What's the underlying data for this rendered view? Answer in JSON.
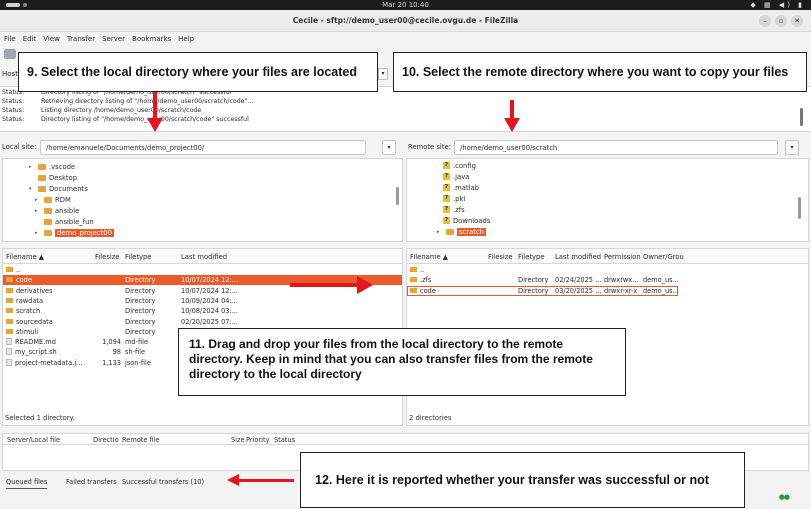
{
  "topbar": {
    "clock": "Mar 20  10:40",
    "tray": "◆ ▦ ◀) ▮"
  },
  "window": {
    "title": "Cecile - sftp://demo_user00@cecile.ovgu.de - FileZilla",
    "minimize": "–",
    "maximize": "▫",
    "close": "✕"
  },
  "menu": [
    "File",
    "Edit",
    "View",
    "Transfer",
    "Server",
    "Bookmarks",
    "Help"
  ],
  "quickconnect": {
    "host_label": "Host:",
    "dropdown": "▾"
  },
  "log": [
    {
      "k": "Status:",
      "v": "Directory listing of \"/home/demo_user00/scratch\" successful"
    },
    {
      "k": "Status:",
      "v": "Retrieving directory listing of \"/home/demo_user00/scratch/code\"..."
    },
    {
      "k": "Status:",
      "v": "Listing directory /home/demo_user00/scratch/code"
    },
    {
      "k": "Status:",
      "v": "Directory listing of \"/home/demo_user00/scratch/code\" successful"
    }
  ],
  "local": {
    "site_label": "Local site:",
    "path": "/home/emanuele/Documents/demo_project00/",
    "tree": [
      {
        "label": ".vscode",
        "indent": 1,
        "exp": "▸"
      },
      {
        "label": "Desktop",
        "indent": 1,
        "exp": ""
      },
      {
        "label": "Documents",
        "indent": 1,
        "exp": "▾"
      },
      {
        "label": "RDM",
        "indent": 2,
        "exp": "▸"
      },
      {
        "label": "ansible",
        "indent": 2,
        "exp": "▸"
      },
      {
        "label": "ansible_fun",
        "indent": 2,
        "exp": ""
      },
      {
        "label": "demo_project00",
        "indent": 2,
        "exp": "▸",
        "selected": true
      }
    ],
    "headers": {
      "name": "Filename ▲",
      "size": "Filesize",
      "type": "Filetype",
      "modified": "Last modified"
    },
    "rows": [
      {
        "name": "..",
        "size": "",
        "type": "",
        "modified": "",
        "kind": "folder"
      },
      {
        "name": "code",
        "size": "",
        "type": "Directory",
        "modified": "10/07/2024 12:...",
        "kind": "folder",
        "selected": true
      },
      {
        "name": "derivatives",
        "size": "",
        "type": "Directory",
        "modified": "10/07/2024 12:...",
        "kind": "folder"
      },
      {
        "name": "rawdata",
        "size": "",
        "type": "Directory",
        "modified": "10/09/2024 04:...",
        "kind": "folder"
      },
      {
        "name": "scratch",
        "size": "",
        "type": "Directory",
        "modified": "10/08/2024 03:...",
        "kind": "folder"
      },
      {
        "name": "sourcedata",
        "size": "",
        "type": "Directory",
        "modified": "02/20/2025 07:...",
        "kind": "folder"
      },
      {
        "name": "stimuli",
        "size": "",
        "type": "Directory",
        "modified": "",
        "kind": "folder"
      },
      {
        "name": "README.md",
        "size": "1,094",
        "type": "md-file",
        "modified": "",
        "kind": "file"
      },
      {
        "name": "my_script.sh",
        "size": "98",
        "type": "sh-file",
        "modified": "",
        "kind": "file"
      },
      {
        "name": "project-metadata.j...",
        "size": "1,133",
        "type": "json-file",
        "modified": "",
        "kind": "file"
      }
    ],
    "status": "Selected 1 directory."
  },
  "remote": {
    "site_label": "Remote site:",
    "path": "/home/demo_user00/scratch",
    "tree": [
      {
        "label": ".config",
        "icon": "q"
      },
      {
        "label": ".java",
        "icon": "q"
      },
      {
        "label": ".matlab",
        "icon": "q"
      },
      {
        "label": ".pki",
        "icon": "q"
      },
      {
        "label": ".zfs",
        "icon": "q"
      },
      {
        "label": "Downloads",
        "icon": "q"
      },
      {
        "label": "scratch",
        "icon": "folder",
        "selected": true
      }
    ],
    "headers": {
      "name": "Filename ▲",
      "size": "Filesize",
      "type": "Filetype",
      "modified": "Last modified",
      "perm": "Permission",
      "owner": "Owner/Grou"
    },
    "rows": [
      {
        "name": "..",
        "type": "",
        "modified": "",
        "perm": "",
        "owner": ""
      },
      {
        "name": ".zfs",
        "type": "Directory",
        "modified": "02/24/2025 ...",
        "perm": "drwxrwx...",
        "owner": "demo_us..."
      },
      {
        "name": "code",
        "type": "Directory",
        "modified": "03/20/2025 ...",
        "perm": "drwxr-xr-x",
        "owner": "demo_us...",
        "outlined": true
      }
    ],
    "status": "2 directories"
  },
  "queue": {
    "headers": [
      "Server/Local file",
      "Directio",
      "Remote file",
      "Size",
      "Priority",
      "Status"
    ],
    "tabs": [
      "Queued files",
      "Failed transfers",
      "Successful transfers (10)"
    ]
  },
  "annotations": {
    "step9": "9. Select the local directory where your files are located",
    "step10": "10. Select the remote directory where you want to copy your files",
    "step11": "11. Drag and drop your files from the local directory to the remote directory. Keep in mind that you can also transfer files from the remote directory to the local directory",
    "step12": "12. Here it is reported whether your transfer was successful or not",
    "accent": "#e4161d"
  }
}
